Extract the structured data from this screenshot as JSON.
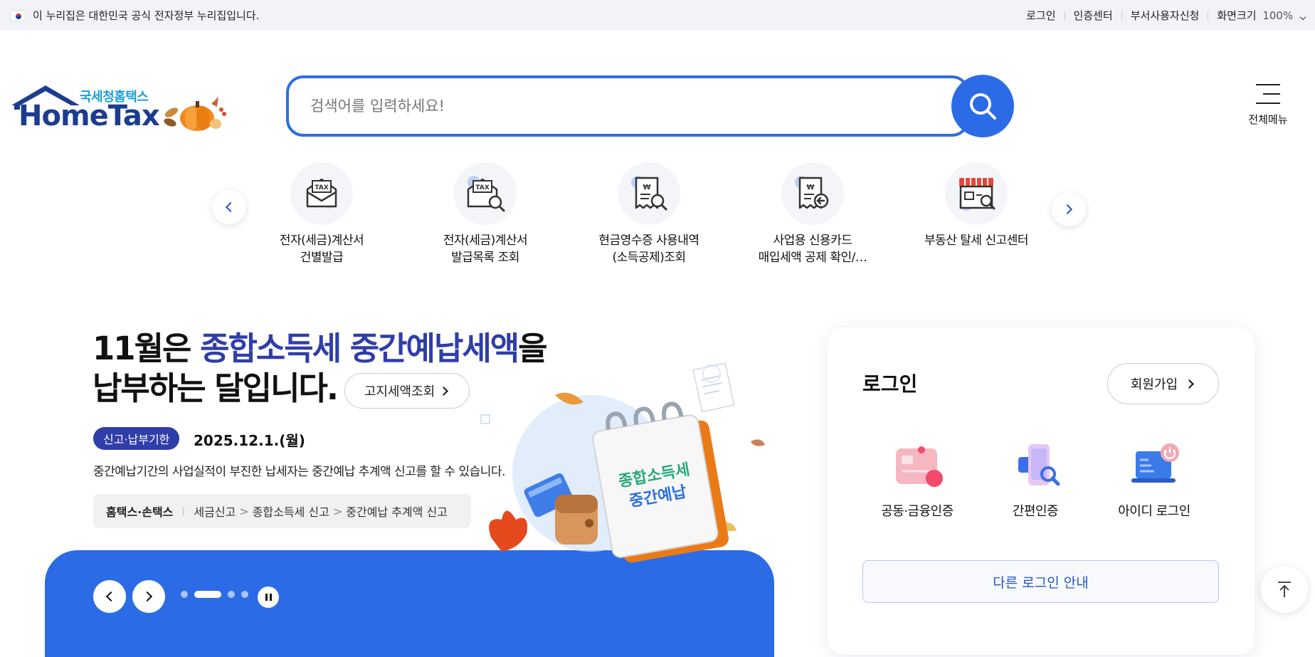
{
  "govbar": {
    "notice": "이 누리집은 대한민국 공식 전자정부 누리집입니다.",
    "links": [
      "로그인",
      "인증센터",
      "부서사용자신청"
    ],
    "zoom_label": "화면크기",
    "zoom_value": "100%"
  },
  "logo": {
    "agency": "국세청홈택스",
    "wordmark": "HomeTax"
  },
  "search": {
    "placeholder": "검색어를 입력하세요!"
  },
  "all_menu": {
    "label": "전체메뉴"
  },
  "quick_services": [
    {
      "line1": "전자(세금)계산서",
      "line2": "건별발급",
      "icon": "tax-envelope-icon"
    },
    {
      "line1": "전자(세금)계산서",
      "line2": "발급목록 조회",
      "icon": "tax-search-icon"
    },
    {
      "line1": "현금영수증 사용내역",
      "line2": "(소득공제)조회",
      "icon": "receipt-search-icon"
    },
    {
      "line1": "사업용 신용카드",
      "line2": "매입세액 공제 확인/…",
      "icon": "receipt-return-icon"
    },
    {
      "line1": "부동산 탈세 신고센터",
      "line2": "",
      "icon": "store-search-icon"
    }
  ],
  "banner": {
    "title_part1": "11월은 ",
    "title_highlight": "종합소득세 중간예납세액",
    "title_part2": "을",
    "title_line2": "납부하는 달입니다.",
    "button": "고지세액조회",
    "deadline_label": "신고·납부기한",
    "deadline_date": "2025.12.1.(월)",
    "description": "중간예납기간의 사업실적이 부진한 납세자는 중간예납 추계액 신고를 할 수 있습니다.",
    "path_site": "홈택스·손택스",
    "path": [
      "세금신고",
      "종합소득세 신고",
      "중간예납 추계액 신고"
    ],
    "illustration_text_line1": "종합소득세",
    "illustration_text_line2": "중간예납"
  },
  "carousel": {
    "slide_count": 4,
    "active_index": 1
  },
  "login": {
    "title": "로그인",
    "join": "회원가입",
    "options": [
      "공동·금융인증",
      "간편인증",
      "아이디 로그인"
    ],
    "other": "다른 로그인 안내"
  },
  "colors": {
    "primary": "#2b6be6",
    "navy": "#2f3ea8",
    "logo_blue": "#1c3d8f"
  }
}
